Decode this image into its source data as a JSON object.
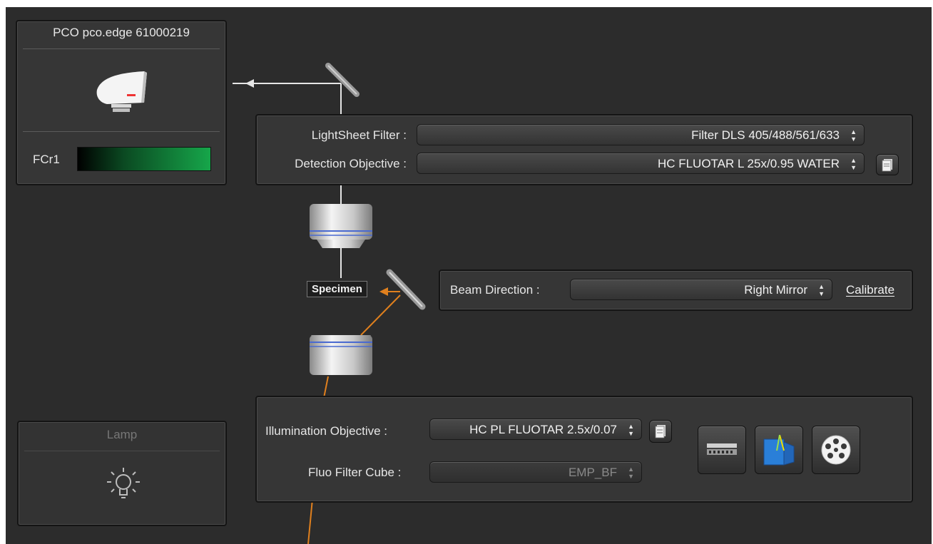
{
  "camera": {
    "title": "PCO pco.edge 61000219",
    "channel_label": "FCr1",
    "icon": "camera-icon",
    "channel_gradient": [
      "#000000",
      "#16a64a"
    ]
  },
  "detection": {
    "lightsheet_filter_label": "LightSheet Filter :",
    "lightsheet_filter_value": "Filter DLS 405/488/561/633",
    "objective_label": "Detection Objective :",
    "objective_value": "HC FLUOTAR L   25x/0.95 WATER"
  },
  "specimen_label": "Specimen",
  "beam": {
    "label": "Beam Direction :",
    "value": "Right Mirror",
    "calibrate": "Calibrate"
  },
  "illumination": {
    "objective_label": "Illumination Objective :",
    "objective_value": "HC PL FLUOTAR   2.5x/0.07",
    "filter_cube_label": "Fluo Filter Cube :",
    "filter_cube_value": "EMP_BF"
  },
  "lamp": {
    "title": "Lamp",
    "icon": "lightbulb-icon"
  },
  "colors": {
    "background": "#2c2c2c",
    "panel": "#363636",
    "beam_orange": "#e0801e",
    "detection_path": "#e6e6e6",
    "filter_active_green": "#16a64a",
    "tool_blue": "#2a7fd8"
  }
}
